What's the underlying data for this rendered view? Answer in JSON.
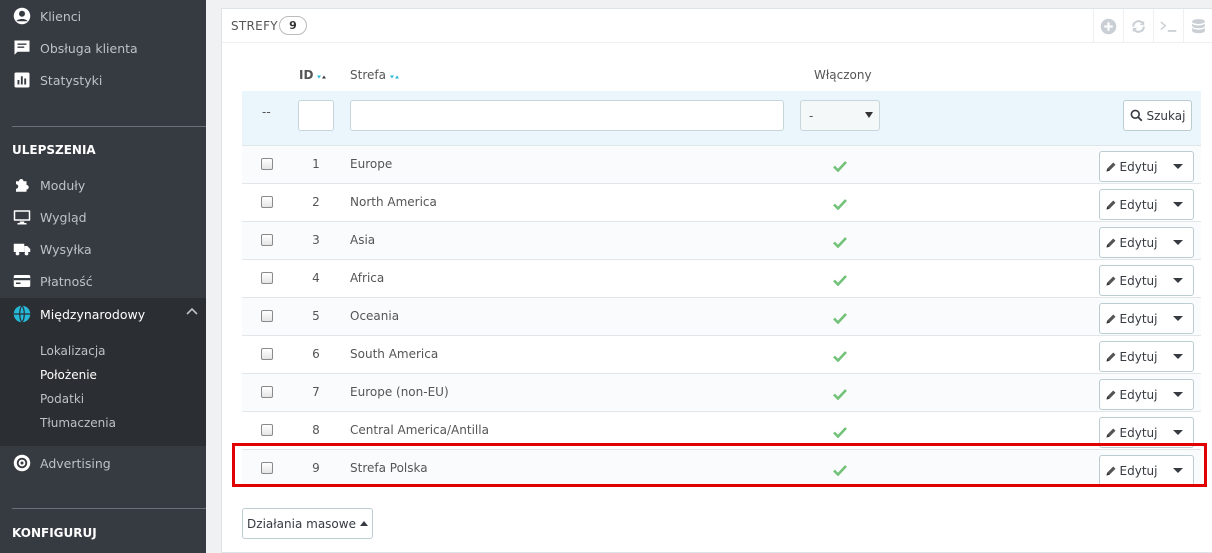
{
  "sidebar": {
    "items_top": [
      {
        "label": "Klienci",
        "icon": "user-circle-icon"
      },
      {
        "label": "Obsługa klienta",
        "icon": "chat-icon"
      },
      {
        "label": "Statystyki",
        "icon": "bar-chart-icon"
      }
    ],
    "section_improvements": "ULEPSZENIA",
    "items_mid": [
      {
        "label": "Moduły",
        "icon": "puzzle-icon"
      },
      {
        "label": "Wygląd",
        "icon": "monitor-icon"
      },
      {
        "label": "Wysyłka",
        "icon": "truck-icon"
      },
      {
        "label": "Płatność",
        "icon": "credit-card-icon"
      },
      {
        "label": "Międzynarodowy",
        "icon": "globe-icon"
      }
    ],
    "subitems": [
      {
        "label": "Lokalizacja"
      },
      {
        "label": "Położenie"
      },
      {
        "label": "Podatki"
      },
      {
        "label": "Tłumaczenia"
      }
    ],
    "advertising": {
      "label": "Advertising",
      "icon": "target-icon"
    },
    "section_configure": "KONFIGURUJ"
  },
  "panel": {
    "title": "STREFY",
    "count": "9",
    "tools": [
      "add-icon",
      "refresh-icon",
      "terminal-icon",
      "database-icon"
    ]
  },
  "table": {
    "headers": {
      "id": "ID",
      "name": "Strefa",
      "enabled": "Włączony"
    },
    "filter": {
      "dash": "--",
      "select_value": "-",
      "search_label": "Szukaj"
    },
    "rows": [
      {
        "id": "1",
        "name": "Europe"
      },
      {
        "id": "2",
        "name": "North America"
      },
      {
        "id": "3",
        "name": "Asia"
      },
      {
        "id": "4",
        "name": "Africa"
      },
      {
        "id": "5",
        "name": "Oceania"
      },
      {
        "id": "6",
        "name": "South America"
      },
      {
        "id": "7",
        "name": "Europe (non-EU)"
      },
      {
        "id": "8",
        "name": "Central America/Antilla"
      },
      {
        "id": "9",
        "name": "Strefa Polska"
      }
    ],
    "edit_label": "Edytuj"
  },
  "bulk_label": "Działania masowe",
  "colors": {
    "sidebar_bg": "#363a41",
    "accent": "#25b9d7",
    "check": "#72c279",
    "highlight": "#e00000"
  }
}
